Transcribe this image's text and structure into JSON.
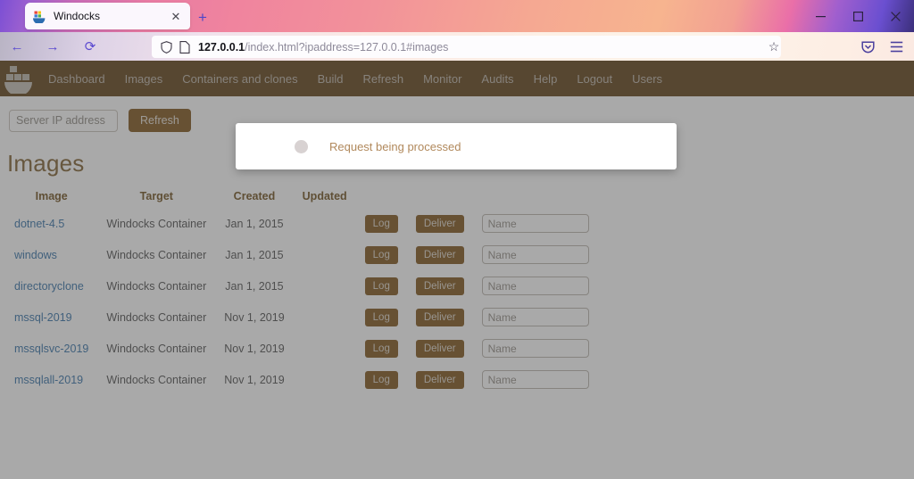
{
  "browser": {
    "tab": {
      "title": "Windocks",
      "favicon": "windocks-favicon",
      "close_label": "✕"
    },
    "new_tab_label": "+",
    "window_controls": {
      "minimize": "–",
      "maximize": "□",
      "close": "✕"
    },
    "nav": {
      "back": "←",
      "forward": "→",
      "reload": "⟳"
    },
    "url": {
      "host": "127.0.0.1",
      "path": "/index.html?ipaddress=127.0.0.1#images"
    },
    "bookmark_label": "☆",
    "toolbar_icons": {
      "pocket": "pocket-icon",
      "menu": "hamburger-menu-icon"
    }
  },
  "app": {
    "brand": "windocks-logo",
    "navlinks": [
      {
        "label": "Dashboard"
      },
      {
        "label": "Images"
      },
      {
        "label": "Containers and clones"
      },
      {
        "label": "Build"
      },
      {
        "label": "Refresh"
      },
      {
        "label": "Monitor"
      },
      {
        "label": "Audits"
      },
      {
        "label": "Help"
      },
      {
        "label": "Logout"
      },
      {
        "label": "Users"
      }
    ],
    "toolbar": {
      "ip_placeholder": "Server IP address",
      "ip_value": "",
      "refresh_label": "Refresh"
    },
    "page_title": "Images",
    "table": {
      "headers": [
        "Image",
        "Target",
        "Created",
        "Updated"
      ],
      "log_label": "Log",
      "deliver_label": "Deliver",
      "name_placeholder": "Name",
      "rows": [
        {
          "image": "dotnet-4.5",
          "target": "Windocks Container",
          "created": "Jan 1, 2015",
          "updated": "",
          "name_value": ""
        },
        {
          "image": "windows",
          "target": "Windocks Container",
          "created": "Jan 1, 2015",
          "updated": "",
          "name_value": ""
        },
        {
          "image": "directoryclone",
          "target": "Windocks Container",
          "created": "Jan 1, 2015",
          "updated": "",
          "name_value": ""
        },
        {
          "image": "mssql-2019",
          "target": "Windocks Container",
          "created": "Nov 1, 2019",
          "updated": "",
          "name_value": ""
        },
        {
          "image": "mssqlsvc-2019",
          "target": "Windocks Container",
          "created": "Nov 1, 2019",
          "updated": "",
          "name_value": ""
        },
        {
          "image": "mssqlall-2019",
          "target": "Windocks Container",
          "created": "Nov 1, 2019",
          "updated": "",
          "name_value": ""
        }
      ]
    },
    "modal": {
      "message": "Request being processed",
      "spinner": "loading-spinner"
    }
  },
  "colors": {
    "brand_brown": "#5b3a0e",
    "button_brown": "#7b4e12",
    "title_brown": "#7b5a28",
    "link_blue": "#2e6da4",
    "modal_text": "#b1895c",
    "overlay": "#808080"
  }
}
